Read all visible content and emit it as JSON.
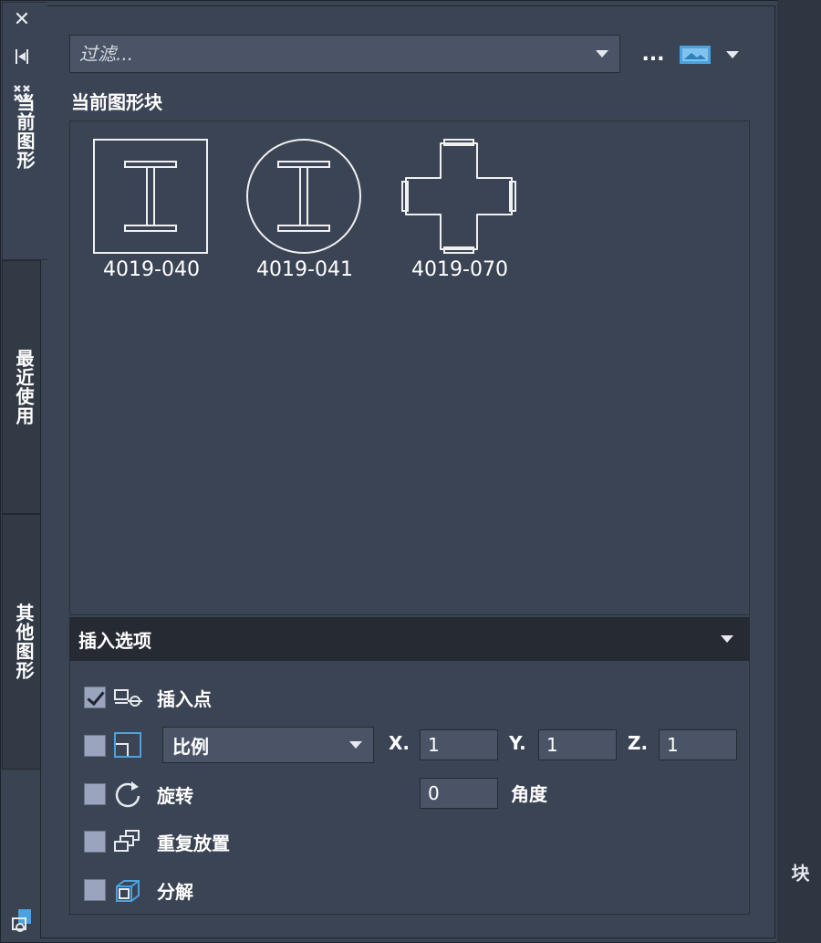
{
  "filter": {
    "placeholder": "过滤..."
  },
  "toolbar": {
    "more_label": "..."
  },
  "vertical_tabs": [
    {
      "label": "当前图形",
      "active": true
    },
    {
      "label": "最近使用",
      "active": false
    },
    {
      "label": "其他图形",
      "active": false
    }
  ],
  "section_title": "当前图形块",
  "blocks": [
    {
      "name": "4019-040",
      "icon": "i-beam-square-icon"
    },
    {
      "name": "4019-041",
      "icon": "i-beam-circle-icon"
    },
    {
      "name": "4019-070",
      "icon": "cross-shape-icon"
    }
  ],
  "insert_options": {
    "header": "插入选项",
    "insert_point": {
      "label": "插入点",
      "checked": true
    },
    "scale": {
      "selected": "比例",
      "checked": false,
      "x_label": "X.",
      "y_label": "Y.",
      "z_label": "Z.",
      "x": "1",
      "y": "1",
      "z": "1"
    },
    "rotate": {
      "label": "旋转",
      "checked": false,
      "angle_value": "0",
      "angle_label": "角度"
    },
    "repeat": {
      "label": "重复放置",
      "checked": false
    },
    "explode": {
      "label": "分解",
      "checked": false
    }
  },
  "right_strip": {
    "caption": "块"
  },
  "colors": {
    "panel": "#3b4454",
    "header": "#252a33",
    "field": "#4a5466",
    "accent": "#4aa3df"
  }
}
